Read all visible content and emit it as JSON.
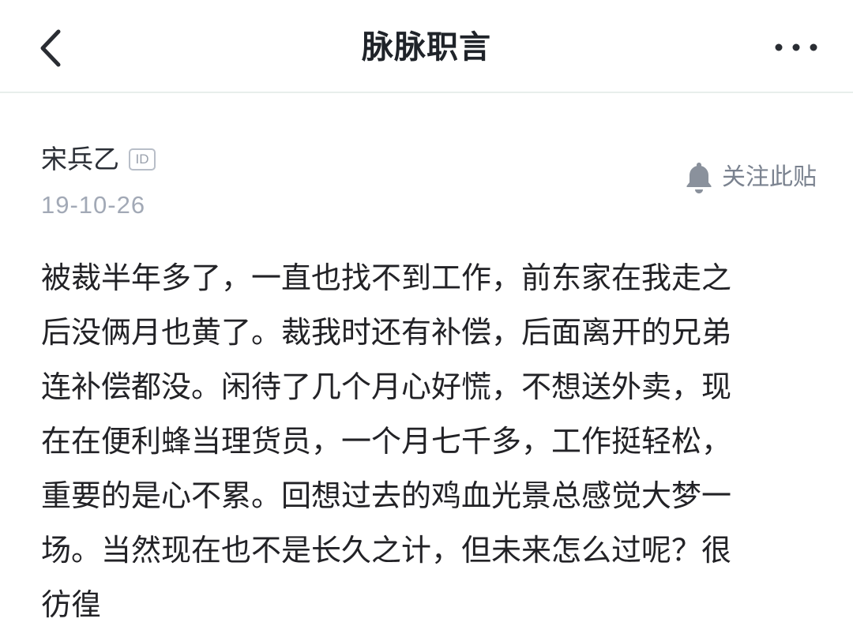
{
  "header": {
    "title": "脉脉职言",
    "back_icon": "chevron-left-icon",
    "more_icon": "more-horizontal-icon"
  },
  "post": {
    "author": "宋兵乙",
    "id_badge": "ID",
    "date": "19-10-26",
    "follow_label": "关注此贴",
    "follow_icon": "bell-icon",
    "lines": [
      "被裁半年多了，一直也找不到工作，前东家在我走之",
      "后没俩月也黄了。裁我时还有补偿，后面离开的兄弟",
      "连补偿都没。闲待了几个月心好慌，不想送外卖，现",
      "在在便利蜂当理货员，一个月七千多，工作挺轻松，",
      "重要的是心不累。回想过去的鸡血光景总感觉大梦一",
      "场。当然现在也不是长久之计，但未来怎么过呢？很",
      "彷徨"
    ]
  },
  "colors": {
    "text": "#222226",
    "muted": "#a2a9b6",
    "divider": "#e8eeec",
    "icon": "#8a919c"
  }
}
